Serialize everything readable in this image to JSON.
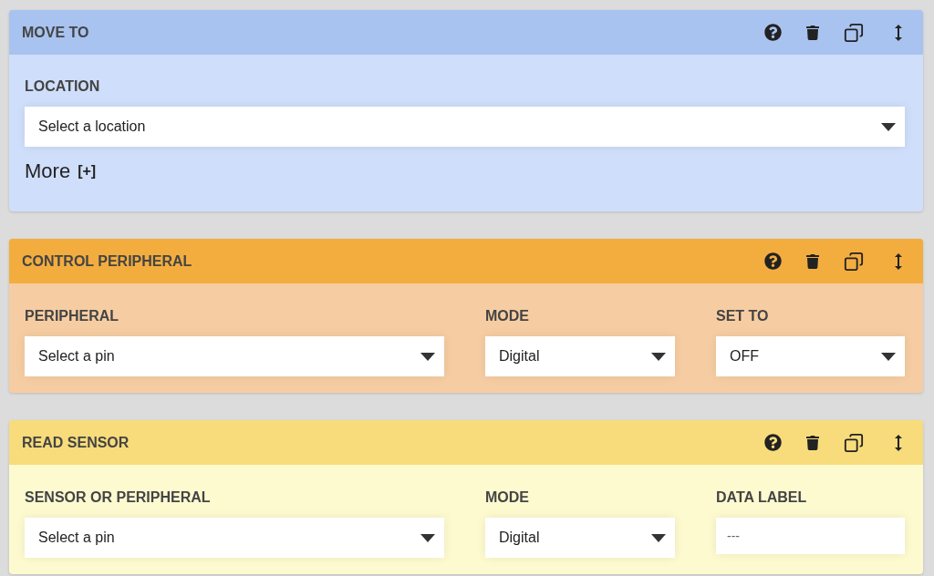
{
  "steps": [
    {
      "kind": "move",
      "title": "MOVE TO",
      "fields": [
        {
          "kind": "select",
          "label": "LOCATION",
          "value": "Select a location"
        }
      ],
      "more": {
        "label": "More",
        "toggle": "[+]"
      }
    },
    {
      "kind": "peripheral",
      "title": "CONTROL PERIPHERAL",
      "fields": [
        {
          "kind": "select",
          "label": "PERIPHERAL",
          "value": "Select a pin"
        },
        {
          "kind": "select",
          "label": "MODE",
          "value": "Digital"
        },
        {
          "kind": "select",
          "label": "SET TO",
          "value": "OFF"
        }
      ]
    },
    {
      "kind": "sensor",
      "title": "READ SENSOR",
      "fields": [
        {
          "kind": "select",
          "label": "SENSOR OR PERIPHERAL",
          "value": "Select a pin"
        },
        {
          "kind": "select",
          "label": "MODE",
          "value": "Digital"
        },
        {
          "kind": "text",
          "label": "DATA LABEL",
          "placeholder": "---"
        }
      ]
    }
  ]
}
